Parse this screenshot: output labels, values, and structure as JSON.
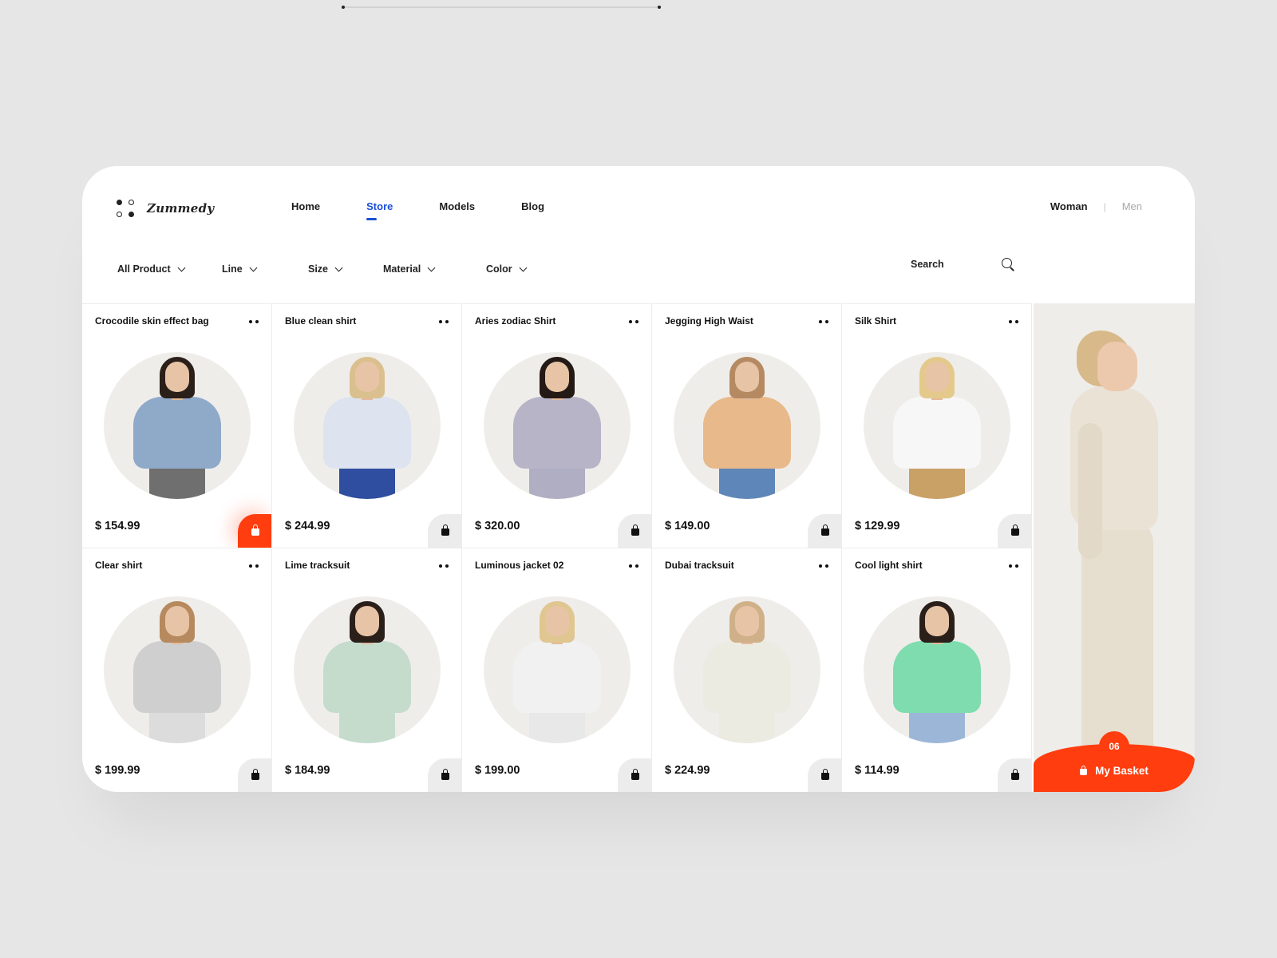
{
  "brand": {
    "name": "Zummedy",
    "logo_icon": "four-dots-logo-icon"
  },
  "nav": {
    "items": [
      {
        "label": "Home",
        "active": false
      },
      {
        "label": "Store",
        "active": true
      },
      {
        "label": "Models",
        "active": false
      },
      {
        "label": "Blog",
        "active": false
      }
    ],
    "active_color": "#1a4fd6"
  },
  "gender": {
    "active": "Woman",
    "separator": "|",
    "inactive": "Men"
  },
  "filters": [
    {
      "label": "All Product",
      "icon": "chevron-down-icon"
    },
    {
      "label": "Line",
      "icon": "chevron-down-icon"
    },
    {
      "label": "Size",
      "icon": "chevron-down-icon"
    },
    {
      "label": "Material",
      "icon": "chevron-down-icon"
    },
    {
      "label": "Color",
      "icon": "chevron-down-icon"
    }
  ],
  "search": {
    "placeholder": "Search",
    "icon": "search-icon"
  },
  "products": [
    {
      "title": "Crocodile skin effect bag",
      "price": "$ 154.99",
      "cart_highlight": true
    },
    {
      "title": "Blue clean shirt",
      "price": "$ 244.99",
      "cart_highlight": false
    },
    {
      "title": "Aries zodiac Shirt",
      "price": "$ 320.00",
      "cart_highlight": false
    },
    {
      "title": "Jegging High Waist",
      "price": "$ 149.00",
      "cart_highlight": false
    },
    {
      "title": "Silk Shirt",
      "price": "$ 129.99",
      "cart_highlight": false
    },
    {
      "title": "Clear shirt",
      "price": "$ 199.99",
      "cart_highlight": false
    },
    {
      "title": "Lime tracksuit",
      "price": "$ 184.99",
      "cart_highlight": false
    },
    {
      "title": "Luminous jacket 02",
      "price": "$ 199.00",
      "cart_highlight": false
    },
    {
      "title": "Dubai tracksuit",
      "price": "$ 224.99",
      "cart_highlight": false
    },
    {
      "title": "Cool light shirt",
      "price": "$ 114.99",
      "cart_highlight": false
    }
  ],
  "basket": {
    "label": "My Basket",
    "count": "06",
    "icon": "shopping-bag-icon"
  },
  "colors": {
    "accent": "#ff3d0f",
    "background": "#e6e6e6",
    "card": "#ffffff"
  }
}
